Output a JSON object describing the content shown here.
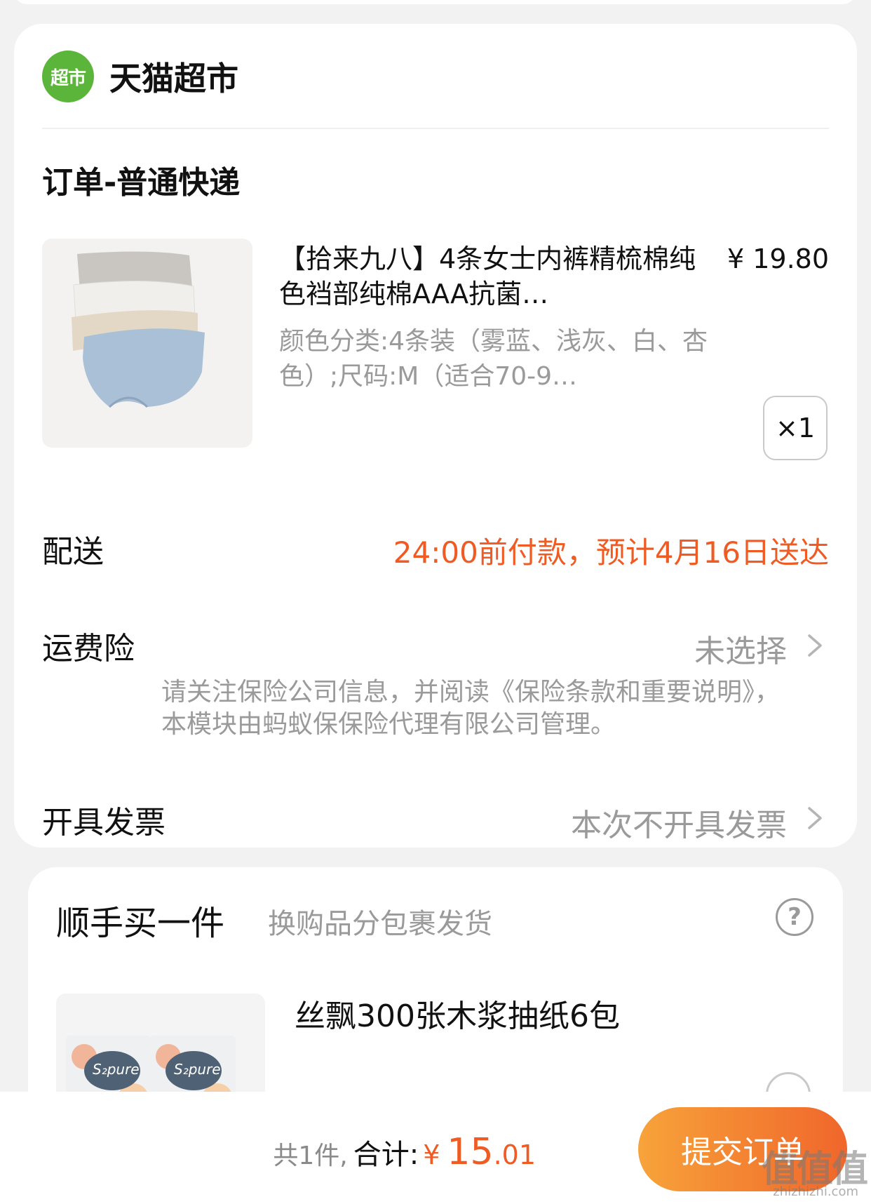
{
  "store": {
    "logo_text": "超市",
    "name": "天猫超市"
  },
  "order": {
    "title": "订单-普通快递"
  },
  "product": {
    "title": "【拾来九八】4条女士内裤精梳棉纯色裆部纯棉AAA抗菌…",
    "price": "¥ 19.80",
    "spec": "颜色分类:4条装（雾蓝、浅灰、白、杏色）;尺码:M（适合70-9…",
    "quantity": "×1"
  },
  "delivery": {
    "label": "配送",
    "value": "24:00前付款，预计4月16日送达"
  },
  "insurance": {
    "label": "运费险",
    "value": "未选择",
    "note": "请关注保险公司信息，并阅读《保险条款和重要说明》，本模块由蚂蚁保保险代理有限公司管理。"
  },
  "invoice": {
    "label": "开具发票",
    "value": "本次不开具发票"
  },
  "addon": {
    "title": "顺手买一件",
    "subtitle": "换购品分包裹发货",
    "help_icon": "?",
    "item_name": "丝飘300张木浆抽纸6包",
    "item_image_text": "S₂pure"
  },
  "footer": {
    "count": "共1件,",
    "total_label": "合计:",
    "currency": "¥",
    "total_int": "15",
    "total_dec": ".01",
    "submit_label": "提交订单"
  },
  "watermark": {
    "text": "值值值",
    "url": "zhizhizhi.com"
  },
  "colors": {
    "accent": "#f05a23",
    "button_start": "#f7a33a",
    "button_end": "#f0662b",
    "store_green": "#5bb53a"
  }
}
